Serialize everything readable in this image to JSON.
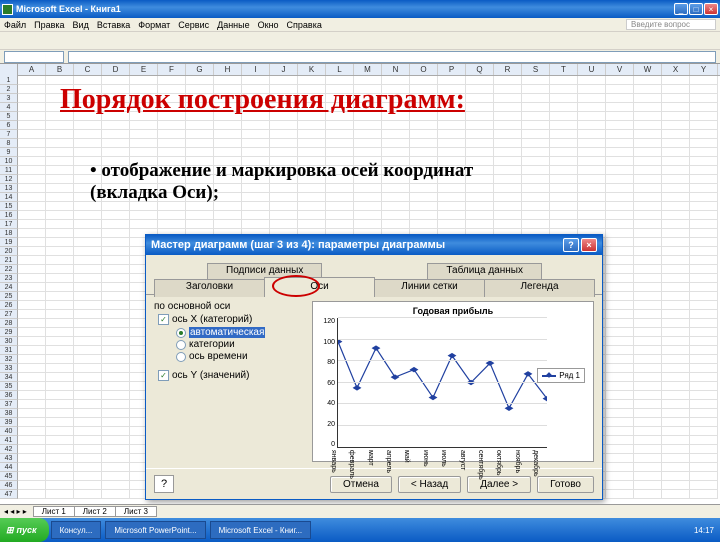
{
  "titlebar": {
    "text": "Microsoft Excel - Книга1"
  },
  "menu": {
    "items": [
      "Файл",
      "Правка",
      "Вид",
      "Вставка",
      "Формат",
      "Сервис",
      "Данные",
      "Окно",
      "Справка"
    ],
    "question": "Введите вопрос"
  },
  "columns": [
    "A",
    "B",
    "C",
    "D",
    "E",
    "F",
    "G",
    "H",
    "I",
    "J",
    "K",
    "L",
    "M",
    "N",
    "O",
    "P",
    "Q",
    "R",
    "S",
    "T",
    "U",
    "V",
    "W",
    "X",
    "Y"
  ],
  "overlay": {
    "title": "Порядок построения диаграмм:",
    "bullet": "отображение и маркировка осей координат (вкладка Оси);"
  },
  "dialog": {
    "title": "Мастер диаграмм (шаг 3 из 4): параметры диаграммы",
    "tabs_top": [
      "Подписи данных",
      "Таблица данных"
    ],
    "tabs_bottom": [
      "Заголовки",
      "Оси",
      "Линии сетки",
      "Легенда"
    ],
    "axis_group": "по основной оси",
    "chk_x": "ось X (категорий)",
    "radio_auto": "автоматическая",
    "radio_cat": "категории",
    "radio_time": "ось времени",
    "chk_y": "ось Y (значений)",
    "preview_title": "Годовая прибыль",
    "legend_label": "Ряд 1",
    "buttons": {
      "cancel": "Отмена",
      "back": "< Назад",
      "next": "Далее >",
      "finish": "Готово"
    }
  },
  "chart_data": {
    "type": "line",
    "title": "Годовая прибыль",
    "xlabel": "",
    "ylabel": "",
    "ylim": [
      0,
      120
    ],
    "categories": [
      "январь",
      "февраль",
      "март",
      "апрель",
      "май",
      "июнь",
      "июль",
      "август",
      "сентябрь",
      "октябрь",
      "ноябрь",
      "декабрь"
    ],
    "series": [
      {
        "name": "Ряд 1",
        "values": [
          98,
          55,
          92,
          65,
          72,
          46,
          85,
          60,
          78,
          36,
          68,
          45
        ]
      }
    ],
    "yticks": [
      0,
      20,
      40,
      60,
      80,
      100,
      120
    ]
  },
  "sheet_tabs": [
    "Лист 1",
    "Лист 2",
    "Лист 3"
  ],
  "taskbar": {
    "start": "пуск",
    "items": [
      "Консул...",
      "Microsoft PowerPoint...",
      "Microsoft Excel - Книг..."
    ],
    "time": "14:17"
  }
}
